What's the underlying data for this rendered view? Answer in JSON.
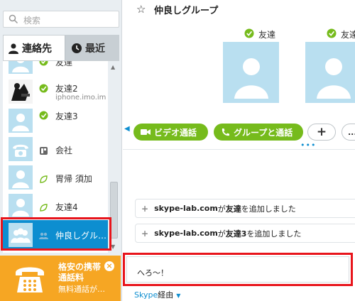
{
  "search": {
    "placeholder": "検索"
  },
  "tabs": {
    "contacts": "連絡先",
    "recent": "最近"
  },
  "contacts": [
    {
      "name": "友達",
      "sub": "",
      "status": "online",
      "avatar": "person"
    },
    {
      "name": "友達2",
      "sub": "iphone.imo.im",
      "status": "online",
      "avatar": "photo"
    },
    {
      "name": "友達3",
      "sub": "",
      "status": "online",
      "avatar": "person"
    },
    {
      "name": "会社",
      "sub": "",
      "status": "phone",
      "avatar": "phone"
    },
    {
      "name": "胃帰 須加",
      "sub": "",
      "status": "offline",
      "avatar": "person"
    },
    {
      "name": "友達4",
      "sub": "",
      "status": "offline",
      "avatar": "person"
    },
    {
      "name": "仲良しグル…",
      "sub": "",
      "status": "group",
      "avatar": "group"
    }
  ],
  "ad": {
    "line1": "格安の携帯",
    "line2": "通話料",
    "line3": "無料通話が…",
    "close": "×"
  },
  "conversation": {
    "title": "仲良しグループ",
    "members": [
      {
        "name": "友達"
      },
      {
        "name": "友達"
      }
    ],
    "buttons": {
      "video": "ビデオ通話",
      "group_call": "グループと通話",
      "add": "+",
      "more": "..."
    },
    "notices": [
      {
        "prefix": "+",
        "who": "skype-lab.com",
        "mid": "が",
        "target": "友達",
        "tail": "を追加しました"
      },
      {
        "prefix": "+",
        "who": "skype-lab.com",
        "mid": "が",
        "target": "友達3",
        "tail": "を追加しました"
      }
    ],
    "message_input": "へろ～！",
    "via": {
      "service": "Skype",
      "suffix": "経由"
    }
  },
  "colors": {
    "accent": "#0d8ed0",
    "green": "#76bb1c",
    "highlight": "#e8141b",
    "ad": "#f6a623"
  }
}
